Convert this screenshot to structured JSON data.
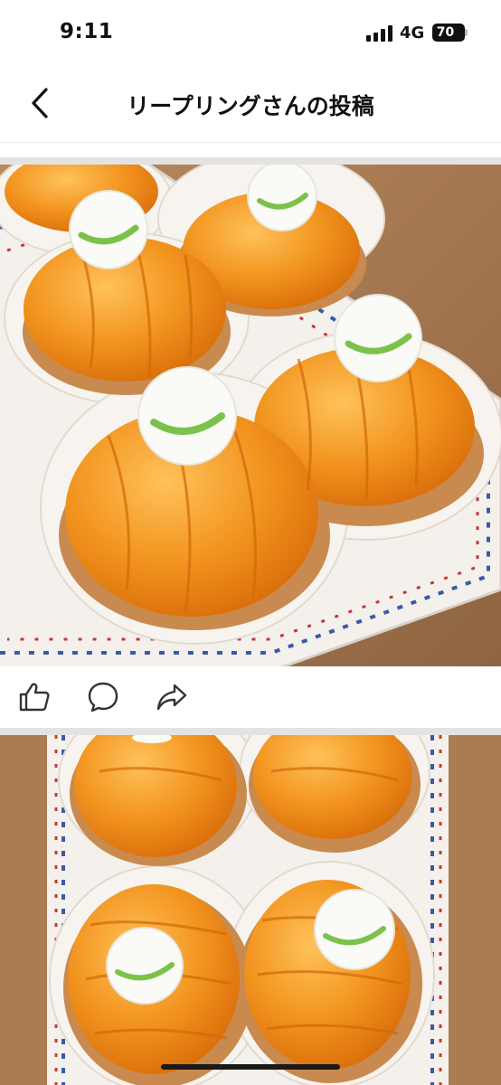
{
  "status_bar": {
    "time": "9:11",
    "network": "4G",
    "battery": "70"
  },
  "header": {
    "back_icon": "chevron-left-icon",
    "title": "リープリングさんの投稿"
  },
  "post_actions": {
    "like_icon": "thumbs-up-icon",
    "comment_icon": "comment-bubble-icon",
    "share_icon": "share-arrow-icon"
  },
  "colors": {
    "tart_orange": "#f2941f",
    "logo_green": "#7cc24a",
    "table_wood": "#a97c52"
  }
}
